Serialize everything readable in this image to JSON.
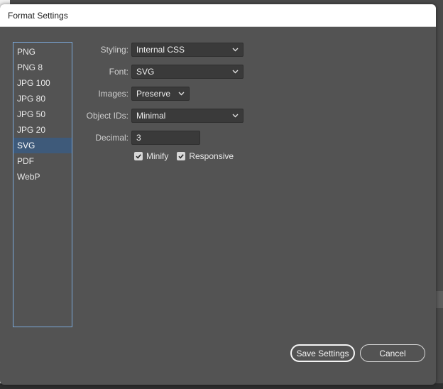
{
  "dialog": {
    "title": "Format Settings"
  },
  "formats": {
    "items": [
      "PNG",
      "PNG 8",
      "JPG 100",
      "JPG 80",
      "JPG 50",
      "JPG 20",
      "SVG",
      "PDF",
      "WebP"
    ],
    "selected": "SVG"
  },
  "settings": {
    "styling": {
      "label": "Styling:",
      "value": "Internal CSS"
    },
    "font": {
      "label": "Font:",
      "value": "SVG"
    },
    "images": {
      "label": "Images:",
      "value": "Preserve"
    },
    "object_ids": {
      "label": "Object IDs:",
      "value": "Minimal"
    },
    "decimal": {
      "label": "Decimal:",
      "value": "3"
    },
    "minify": {
      "label": "Minify",
      "checked": true
    },
    "responsive": {
      "label": "Responsive",
      "checked": true
    }
  },
  "buttons": {
    "save_label": "Save Settings",
    "cancel_label": "Cancel"
  },
  "colors": {
    "dialog_bg": "#535353",
    "selection": "#3e5a7a",
    "list_border": "#7aa7d8"
  },
  "icons": {
    "dropdown": "chevron-down-icon",
    "checkbox": "checkmark-icon"
  }
}
